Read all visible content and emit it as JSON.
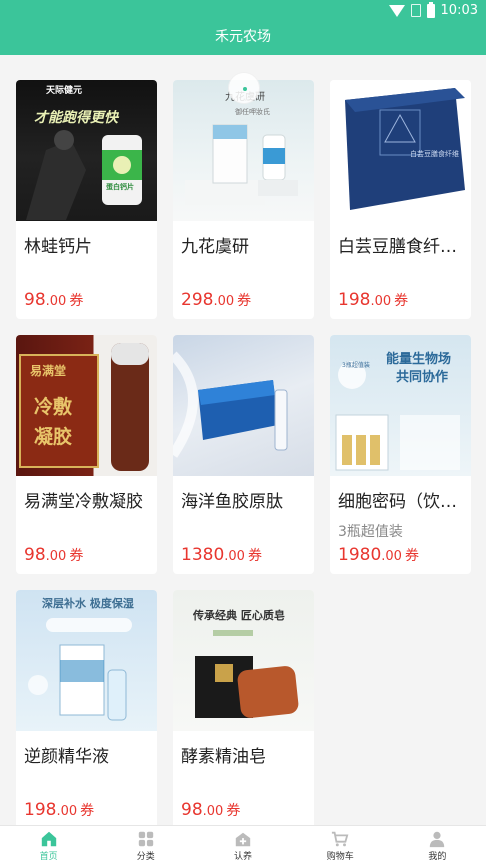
{
  "status_bar": {
    "time": "10:03"
  },
  "header": {
    "title": "禾元农场"
  },
  "products": [
    {
      "name": "林蛙钙片",
      "subtitle": "",
      "price_int": "98",
      "price_dec": ".00",
      "price_unit": "券",
      "image_text": [
        "天际健元",
        "才能跑得更快",
        "蛋白钙片"
      ]
    },
    {
      "name": "九花虞研",
      "subtitle": "",
      "price_int": "298",
      "price_dec": ".00",
      "price_unit": "券",
      "image_text": [
        "九花虞研",
        "御任呷妝氏"
      ]
    },
    {
      "name": "白芸豆膳食纤…",
      "subtitle": "",
      "price_int": "198",
      "price_dec": ".00",
      "price_unit": "券",
      "image_text": [
        "白芸豆膳食纤维"
      ]
    },
    {
      "name": "易满堂冷敷凝胶",
      "subtitle": "",
      "price_int": "98",
      "price_dec": ".00",
      "price_unit": "券",
      "image_text": [
        "易满堂",
        "冷敷",
        "凝胶"
      ]
    },
    {
      "name": "海洋鱼胶原肽",
      "subtitle": "",
      "price_int": "1380",
      "price_dec": ".00",
      "price_unit": "券",
      "image_text": []
    },
    {
      "name": "细胞密码（饮…",
      "subtitle": "3瓶超值装",
      "price_int": "1980",
      "price_dec": ".00",
      "price_unit": "券",
      "image_text": [
        "能量生物场",
        "共同协作",
        "3瓶超值装"
      ]
    },
    {
      "name": "逆颜精华液",
      "subtitle": "",
      "price_int": "198",
      "price_dec": ".00",
      "price_unit": "券",
      "image_text": [
        "深层补水 极度保湿"
      ]
    },
    {
      "name": "酵素精油皂",
      "subtitle": "",
      "price_int": "98",
      "price_dec": ".00",
      "price_unit": "券",
      "image_text": [
        "传承经典 匠心质皂"
      ]
    }
  ],
  "tabbar": {
    "items": [
      {
        "label": "首页",
        "icon": "home-icon",
        "active": true
      },
      {
        "label": "分类",
        "icon": "grid-icon",
        "active": false
      },
      {
        "label": "认养",
        "icon": "adopt-icon",
        "active": false
      },
      {
        "label": "购物车",
        "icon": "cart-icon",
        "active": false
      },
      {
        "label": "我的",
        "icon": "user-icon",
        "active": false
      }
    ]
  },
  "colors": {
    "brand": "#3bc59a",
    "price": "#e8362f"
  }
}
